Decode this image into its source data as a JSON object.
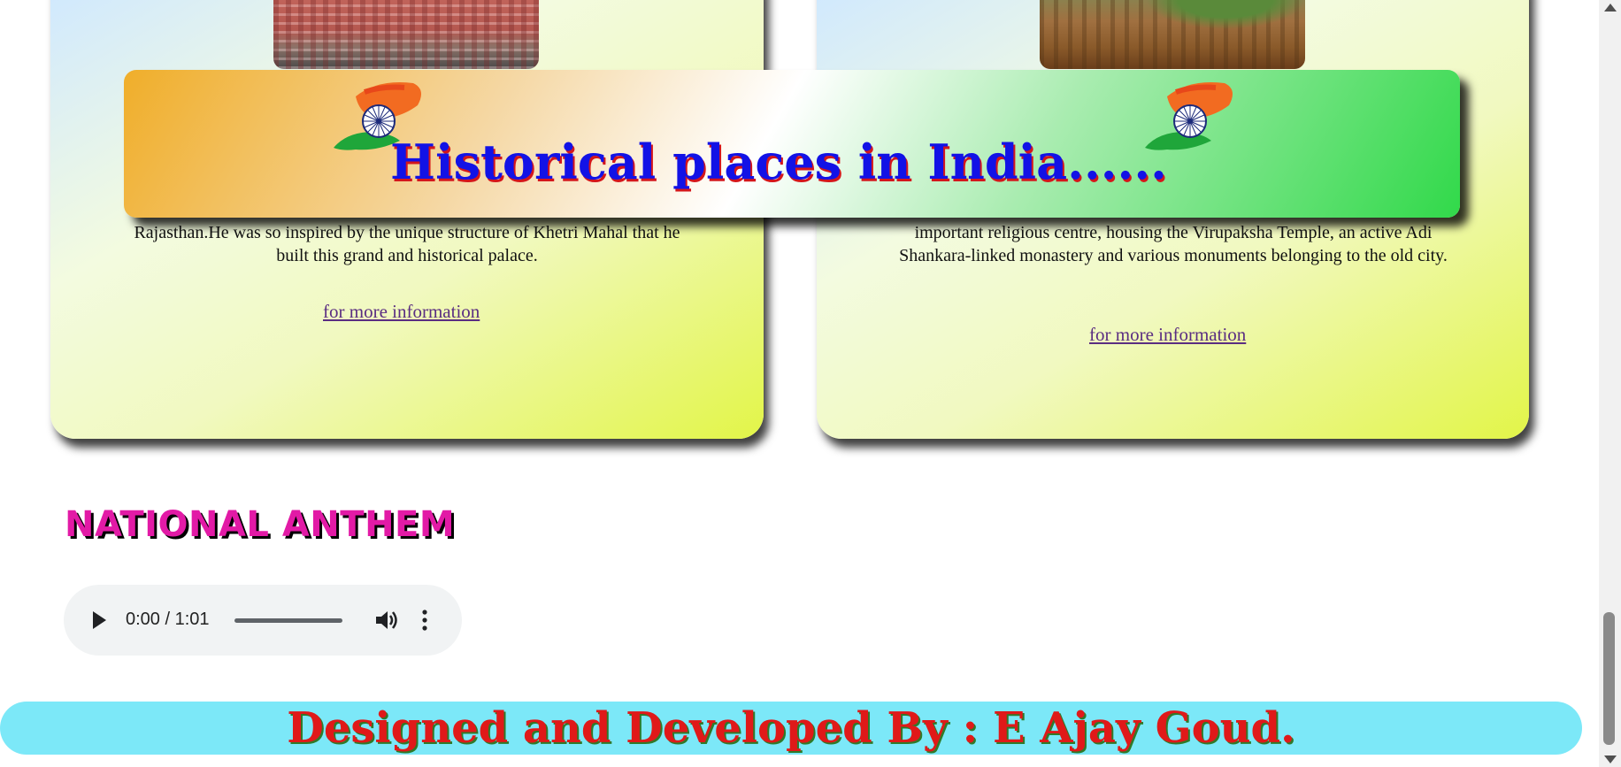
{
  "cards": [
    {
      "text": "Rajasthan.He was so inspired by the unique structure of Khetri Mahal that he built this grand and historical palace.",
      "link": "for more information"
    },
    {
      "text": "important religious centre, housing the Virupaksha Temple, an active Adi Shankara-linked monastery and various monuments belonging to the old city.",
      "link": "for more information"
    }
  ],
  "banner": {
    "title": "Historical places in India......"
  },
  "anthem": {
    "heading": "NATIONAL ANTHEM",
    "time": "0:00 / 1:01",
    "progress": 0
  },
  "footer": {
    "text": "Designed and Developed By : E Ajay Goud."
  },
  "colors": {
    "banner_title": "#1212e6",
    "anthem_heading": "#e21aa6",
    "footer_bg": "#7ce8f8",
    "footer_text": "#e01919"
  },
  "icons": [
    "india-flag-icon",
    "play-icon",
    "volume-icon",
    "more-options-icon"
  ]
}
